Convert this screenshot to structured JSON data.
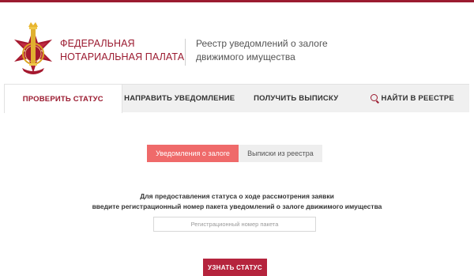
{
  "header": {
    "org_name_line1": "ФЕДЕРАЛЬНАЯ",
    "org_name_line2": "НОТАРИАЛЬНАЯ ПАЛАТА",
    "registry_line1": "Реестр уведомлений о залоге",
    "registry_line2": "движимого имущества"
  },
  "nav": {
    "items": [
      {
        "label": "ПРОВЕРИТЬ СТАТУС",
        "active": true
      },
      {
        "label": "НАПРАВИТЬ УВЕДОМЛЕНИЕ",
        "active": false
      },
      {
        "label": "ПОЛУЧИТЬ ВЫПИСКУ",
        "active": false
      },
      {
        "label": "НАЙТИ В РЕЕСТРЕ",
        "active": false,
        "icon": "search-icon"
      }
    ]
  },
  "toggle": {
    "notifications_label": "Уведомления о залоге",
    "extracts_label": "Выписки из реестра",
    "selected": "notifications"
  },
  "form": {
    "instruction_line1": "Для предоставления статуса о ходе рассмотрения заявки",
    "instruction_line2": "введите регистрационный номер пакета уведомлений о залоге движимого имущества",
    "registration_placeholder": "Регистрационный номер пакета",
    "submit_label": "УЗНАТЬ СТАТУС"
  },
  "colors": {
    "brand": "#9b1b30",
    "toggle_active": "#ef6a6a",
    "submit": "#b5243d"
  }
}
